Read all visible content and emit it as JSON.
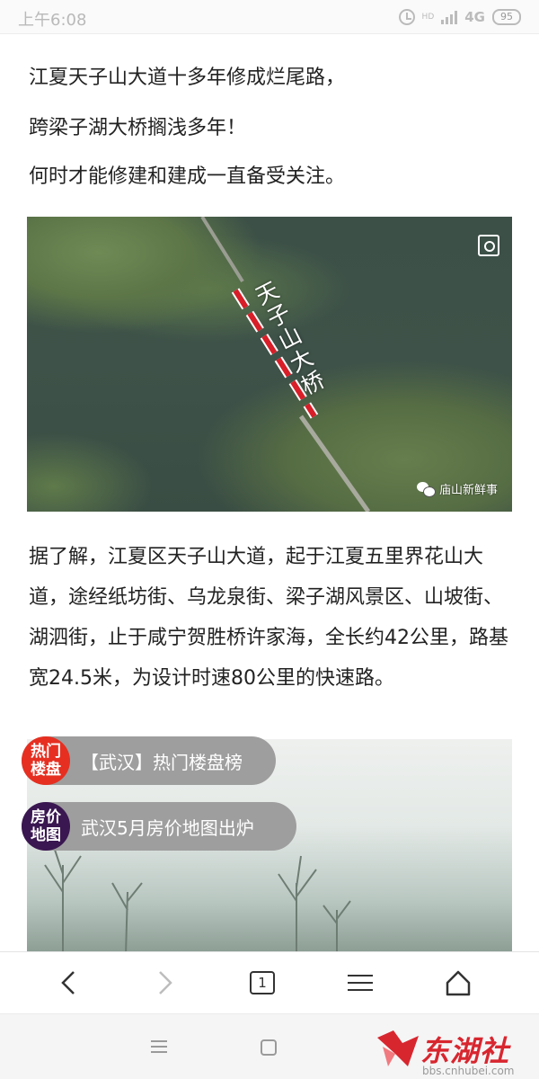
{
  "status_bar": {
    "time": "上午6:08",
    "hd": "HD",
    "network": "4G",
    "battery": "95"
  },
  "article": {
    "headline_lines": [
      "江夏天子山大道十多年修成烂尾路，",
      "跨梁子湖大桥搁浅多年！",
      "何时才能修建和建成一直备受关注。"
    ],
    "image1": {
      "map_label": "天子山大桥",
      "watermark": "庙山新鲜事"
    },
    "paragraph": "据了解，江夏区天子山大道，起于江夏五里界花山大道，途经纸坊街、乌龙泉街、梁子湖风景区、山坡街、湖泗街，止于咸宁贺胜桥许家海，全长约42公里，路基宽24.5米，为设计时速80公里的快速路。"
  },
  "promos": [
    {
      "icon_text": "热门楼盘",
      "label": "【武汉】热门楼盘榜",
      "color": "#e62f21"
    },
    {
      "icon_text": "房价地图",
      "label": "武汉5月房价地图出炉",
      "color": "#3a1750"
    }
  ],
  "toolbar": {
    "tab_count": "1",
    "buttons": [
      "back-icon",
      "forward-icon",
      "tabs-icon",
      "menu-icon",
      "home-icon"
    ]
  },
  "system_nav": {
    "logo_text": "东湖社区",
    "logo_url": "bbs.cnhubei.com"
  }
}
